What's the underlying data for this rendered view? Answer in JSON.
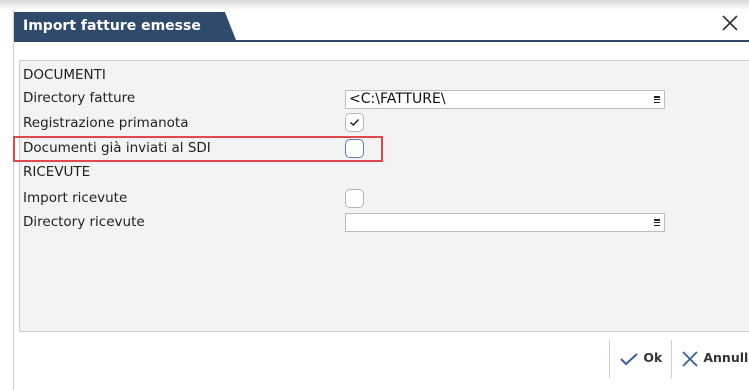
{
  "dialog": {
    "title": "Import fatture emesse"
  },
  "documenti": {
    "section_label": "DOCUMENTI",
    "directory_fatture_label": "Directory fatture",
    "directory_fatture_value": "<C:\\FATTURE\\",
    "registrazione_primanota_label": "Registrazione primanota",
    "registrazione_primanota_checked": true,
    "documenti_inviati_sdi_label": "Documenti già inviati al SDI",
    "documenti_inviati_sdi_checked": false
  },
  "ricevute": {
    "section_label": "RICEVUTE",
    "import_ricevute_label": "Import ricevute",
    "import_ricevute_checked": false,
    "directory_ricevute_label": "Directory ricevute",
    "directory_ricevute_value": ""
  },
  "footer": {
    "ok_label": "Ok",
    "annulla_label": "Annulla"
  },
  "colors": {
    "title_bar": "#2f4a6b",
    "highlight": "#e0484f",
    "checkbox_focus": "#5b7fb0"
  }
}
